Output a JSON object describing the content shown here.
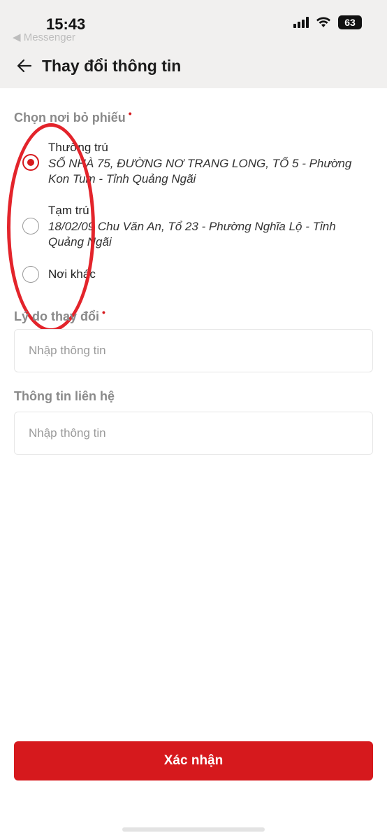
{
  "status_bar": {
    "time": "15:43",
    "back_app": "◀ Messenger",
    "battery": "63"
  },
  "header": {
    "title": "Thay đổi thông tin"
  },
  "voting_place": {
    "label": "Chọn nơi bỏ phiếu",
    "required_mark": "•",
    "options": [
      {
        "title": "Thường trú",
        "address": "SỐ NHÀ 75, ĐƯỜNG NƠ TRANG LONG, TỔ 5 - Phường Kon Tum - Tỉnh Quảng Ngãi",
        "selected": true
      },
      {
        "title": "Tạm trú",
        "address": "18/02/09 Chu Văn An, Tổ 23 - Phường Nghĩa Lộ - Tỉnh Quảng Ngãi",
        "selected": false
      },
      {
        "title": "Nơi khác",
        "selected": false
      }
    ]
  },
  "reason": {
    "label": "Lý do thay đổi",
    "required_mark": "•",
    "placeholder": "Nhập thông tin",
    "value": ""
  },
  "contact": {
    "label": "Thông tin liên hệ",
    "placeholder": "Nhập thông tin",
    "value": ""
  },
  "confirm_button": {
    "label": "Xác nhận"
  },
  "colors": {
    "accent": "#d6191d",
    "header_bg": "#f1f0ef",
    "annotation": "#e3242b"
  },
  "icons": {
    "back": "arrow-left-icon",
    "signal": "cellular-signal-icon",
    "wifi": "wifi-icon",
    "battery": "battery-icon"
  }
}
